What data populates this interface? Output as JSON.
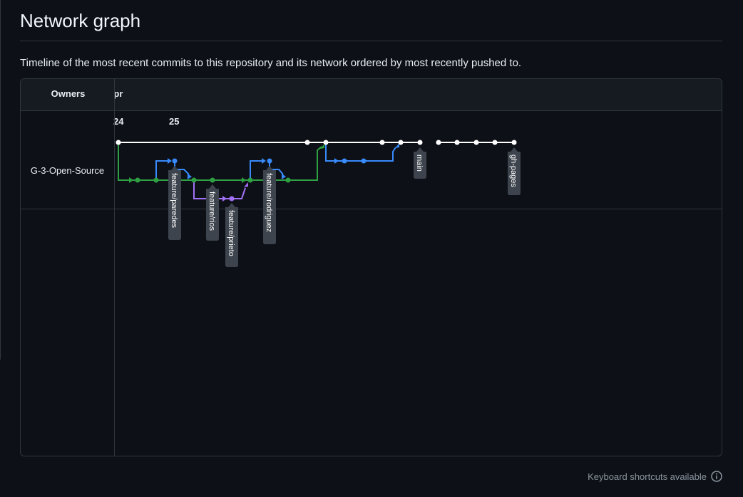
{
  "header": {
    "title": "Network graph"
  },
  "description": "Timeline of the most recent commits to this repository and its network ordered by most recently pushed to.",
  "graph": {
    "owners_label": "Owners",
    "month_label": "Apr",
    "days": [
      "24",
      "25"
    ],
    "owner": "G-3-Open-Source",
    "branches": [
      "main",
      "gh-pages",
      "feature/paredes",
      "feature/rios",
      "feature/prieto",
      "feature/rodriguez"
    ],
    "colors": {
      "main": "#ffffff",
      "green": "#2ea043",
      "blue": "#388bfd",
      "purple": "#a371f7",
      "tag_bg": "#3d444d"
    }
  },
  "footer": {
    "shortcuts": "Keyboard shortcuts available",
    "icon": "info-icon"
  }
}
